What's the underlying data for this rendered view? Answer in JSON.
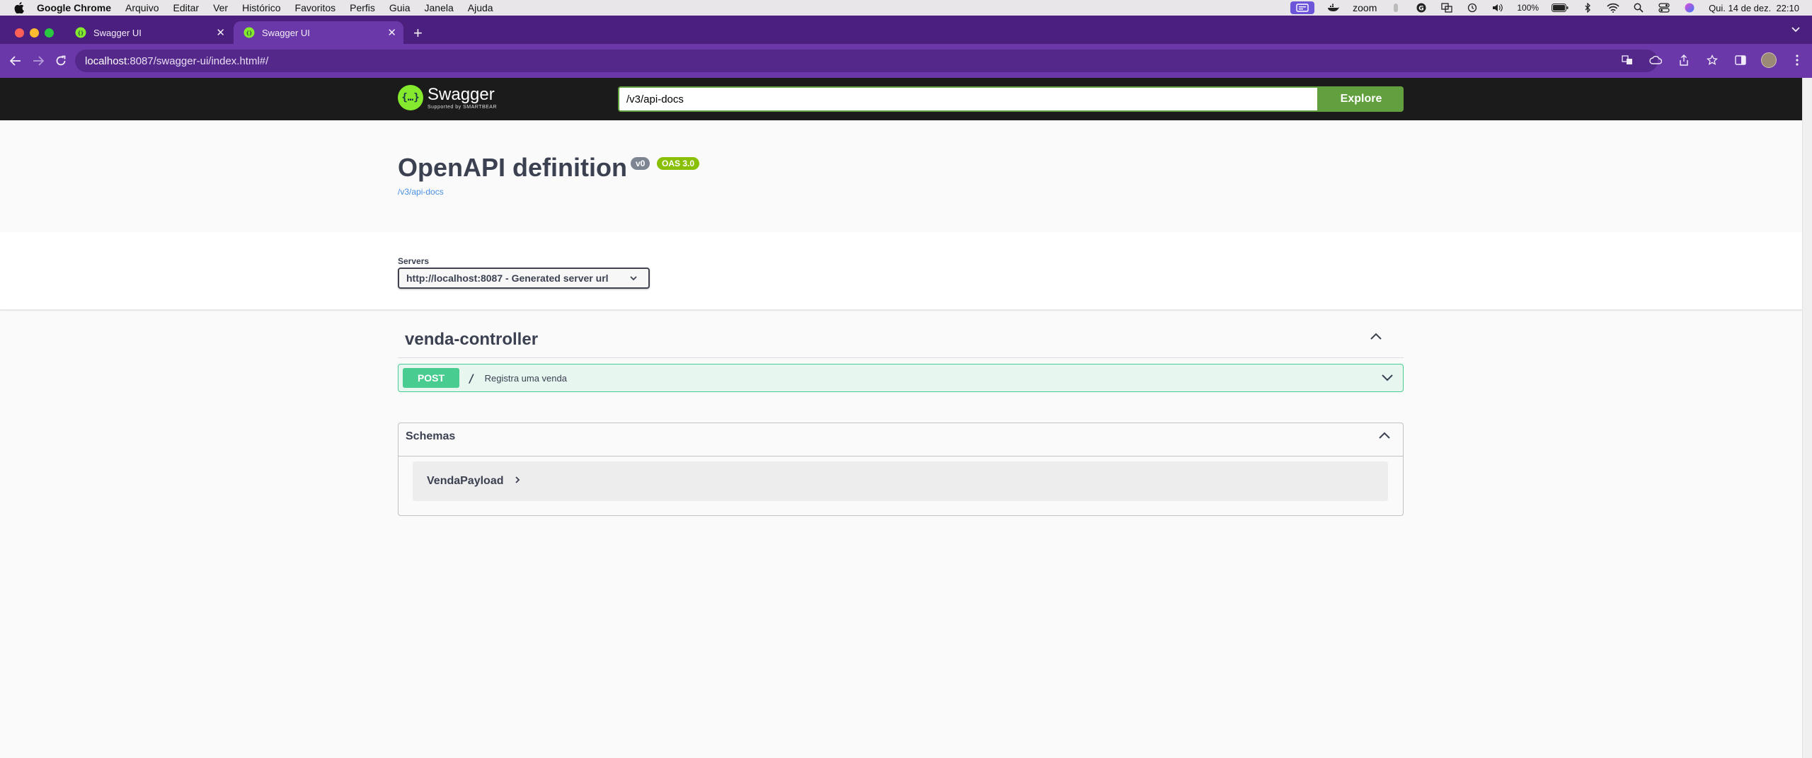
{
  "menubar": {
    "app": "Google Chrome",
    "items": [
      "Arquivo",
      "Editar",
      "Ver",
      "Histórico",
      "Favoritos",
      "Perfis",
      "Guia",
      "Janela",
      "Ajuda"
    ],
    "status": {
      "zoom": "zoom",
      "battery": "100%",
      "datetime": "Qui. 14 de dez.  22:10"
    }
  },
  "tabs": [
    {
      "title": "Swagger UI",
      "active": false
    },
    {
      "title": "Swagger UI",
      "active": true
    }
  ],
  "address": {
    "host": "localhost",
    "rest": ":8087/swagger-ui/index.html#/"
  },
  "swagger": {
    "logo_name": "Swagger",
    "logo_sub": "Supported by SMARTBEAR",
    "url_value": "/v3/api-docs",
    "explore_label": "Explore"
  },
  "info": {
    "title": "OpenAPI definition",
    "version": "v0",
    "oas": "OAS 3.0",
    "link": "/v3/api-docs"
  },
  "servers": {
    "label": "Servers",
    "selected": "http://localhost:8087 - Generated server url"
  },
  "controller": {
    "name": "venda-controller",
    "operations": [
      {
        "method": "POST",
        "path": "/",
        "summary": "Registra uma venda"
      }
    ]
  },
  "schemas": {
    "title": "Schemas",
    "models": [
      "VendaPayload"
    ]
  },
  "colors": {
    "chrome_tabbar": "#4b1f7e",
    "chrome_toolbar": "#6a38a8",
    "swagger_topbar": "#1b1b1b",
    "explore_green": "#62a03f",
    "post_green": "#49cc90",
    "oas_badge": "#89bf04"
  }
}
